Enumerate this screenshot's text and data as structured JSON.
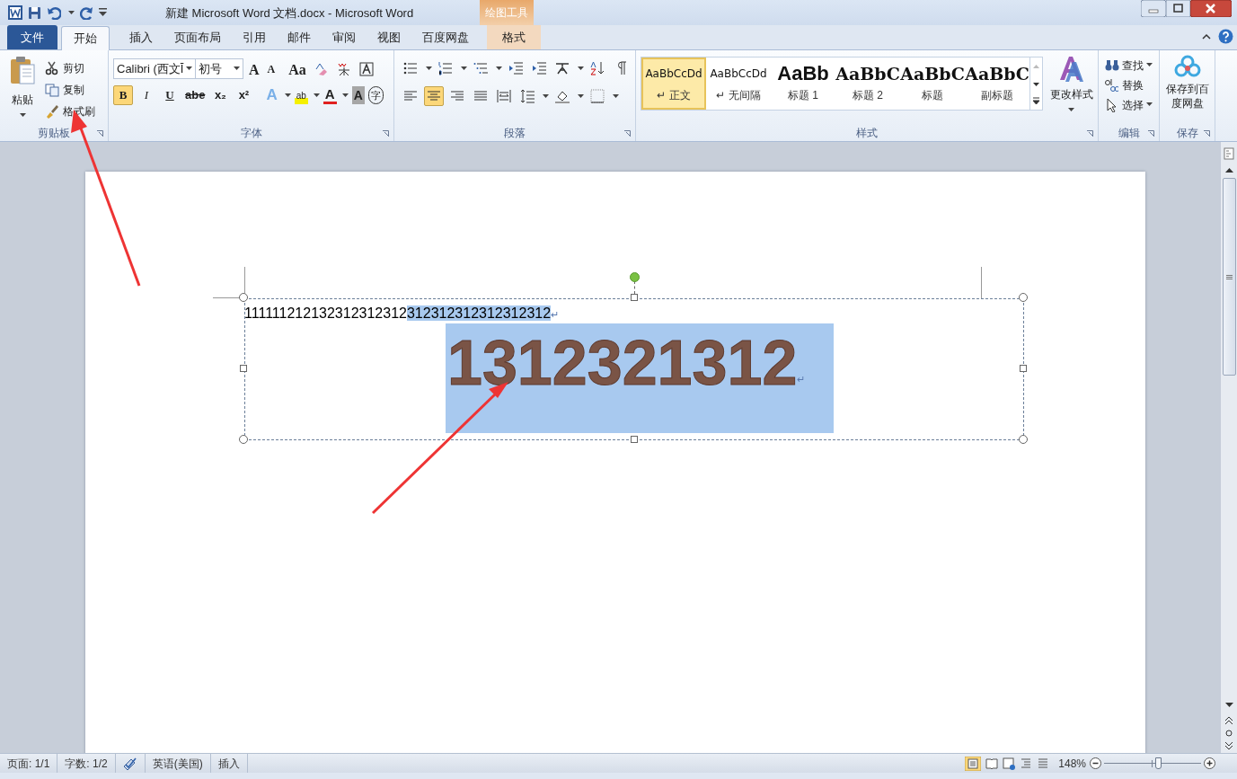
{
  "window": {
    "title": "新建 Microsoft Word 文档.docx - Microsoft Word",
    "contextual_group": "绘图工具"
  },
  "tabs": [
    {
      "label": "文件",
      "kind": "file",
      "selected": false
    },
    {
      "label": "开始",
      "kind": "normal",
      "selected": true
    },
    {
      "label": "插入",
      "kind": "normal",
      "selected": false
    },
    {
      "label": "页面布局",
      "kind": "normal",
      "selected": false
    },
    {
      "label": "引用",
      "kind": "normal",
      "selected": false
    },
    {
      "label": "邮件",
      "kind": "normal",
      "selected": false
    },
    {
      "label": "审阅",
      "kind": "normal",
      "selected": false
    },
    {
      "label": "视图",
      "kind": "normal",
      "selected": false
    },
    {
      "label": "百度网盘",
      "kind": "normal",
      "selected": false
    },
    {
      "label": "格式",
      "kind": "contextual",
      "selected": false
    }
  ],
  "clipboard": {
    "paste": "粘贴",
    "actions": [
      "剪切",
      "复制",
      "格式刷"
    ],
    "label": "剪贴板"
  },
  "font": {
    "font_name": "Calibri (西文Ī",
    "font_size": "初号",
    "size_buttons": [
      "A",
      "A",
      "Aa"
    ],
    "format_buttons": [
      {
        "glyph": "B",
        "selected": true
      },
      {
        "glyph": "I",
        "selected": false
      },
      {
        "glyph": "U",
        "selected": false
      },
      {
        "glyph": "abe",
        "selected": false
      },
      {
        "glyph": "x₂",
        "selected": false
      },
      {
        "glyph": "x²",
        "selected": false
      }
    ],
    "effect_glyphs": [
      "A",
      "ab",
      "A",
      "A",
      "字"
    ],
    "label": "字体"
  },
  "paragraph": {
    "alignment": [
      {
        "selected": false
      },
      {
        "selected": true
      },
      {
        "selected": false
      },
      {
        "selected": false
      },
      {
        "selected": false
      }
    ],
    "label": "段落"
  },
  "styles": {
    "items": [
      {
        "preview": "AaBbCcDd",
        "name": "↵ 正文",
        "kind": "plain",
        "selected": true
      },
      {
        "preview": "AaBbCcDd",
        "name": "↵ 无间隔",
        "kind": "plain",
        "selected": false
      },
      {
        "preview": "AaBb",
        "name": "标题 1",
        "kind": "heading1",
        "selected": false
      },
      {
        "preview": "AaBbC",
        "name": "标题 2",
        "kind": "heading",
        "selected": false
      },
      {
        "preview": "AaBbC",
        "name": "标题",
        "kind": "heading",
        "selected": false
      },
      {
        "preview": "AaBbC",
        "name": "副标题",
        "kind": "heading",
        "selected": false
      }
    ],
    "change_styles": "更改样式",
    "label": "样式"
  },
  "editing": {
    "actions": [
      "查找",
      "替换",
      "选择"
    ],
    "label": "编辑"
  },
  "save": {
    "button": "保存到百度网盘",
    "label": "保存"
  },
  "document": {
    "line1_plain": "111111212132312312312",
    "line1_selected": "312312312312312312",
    "big_text": "1312321312",
    "mark": "↵"
  },
  "status_bar": {
    "page": "页面: 1/1",
    "words": "字数: 1/2",
    "language": "英语(美国)",
    "mode": "插入",
    "zoom": "148%",
    "zoom_slider": {
      "level": 0.56
    }
  }
}
